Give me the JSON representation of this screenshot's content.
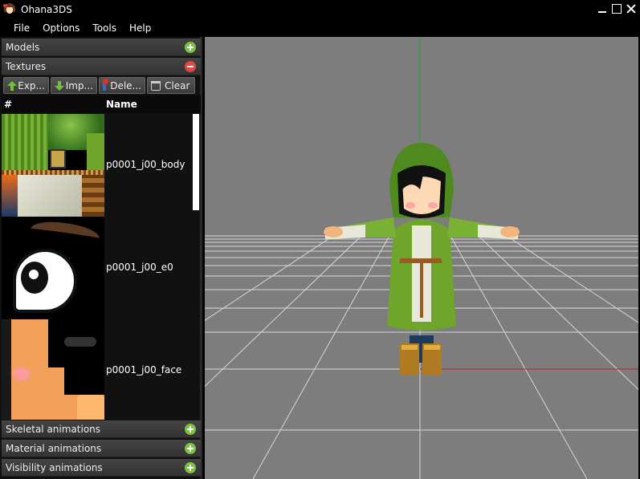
{
  "window": {
    "title": "Ohana3DS"
  },
  "menu": [
    "File",
    "Options",
    "Tools",
    "Help"
  ],
  "sections": {
    "models": "Models",
    "textures": "Textures",
    "skeletal": "Skeletal animations",
    "material": "Material animations",
    "visibility": "Visibility animations"
  },
  "toolbar": {
    "export": "Exp...",
    "import": "Imp...",
    "delete": "Dele...",
    "clear": "Clear"
  },
  "table": {
    "col_index": "#",
    "col_name": "Name",
    "rows": [
      {
        "name": "p0001_j00_body"
      },
      {
        "name": "p0001_j00_e0"
      },
      {
        "name": "p0001_j00_face"
      }
    ]
  },
  "colors": {
    "background": "#000000",
    "panel": "#111111",
    "viewport": "#7d7d7d",
    "expand": "#7cc142",
    "collapse": "#e04848",
    "axis_y": "#2f9b2f",
    "axis_x": "#c42020"
  }
}
